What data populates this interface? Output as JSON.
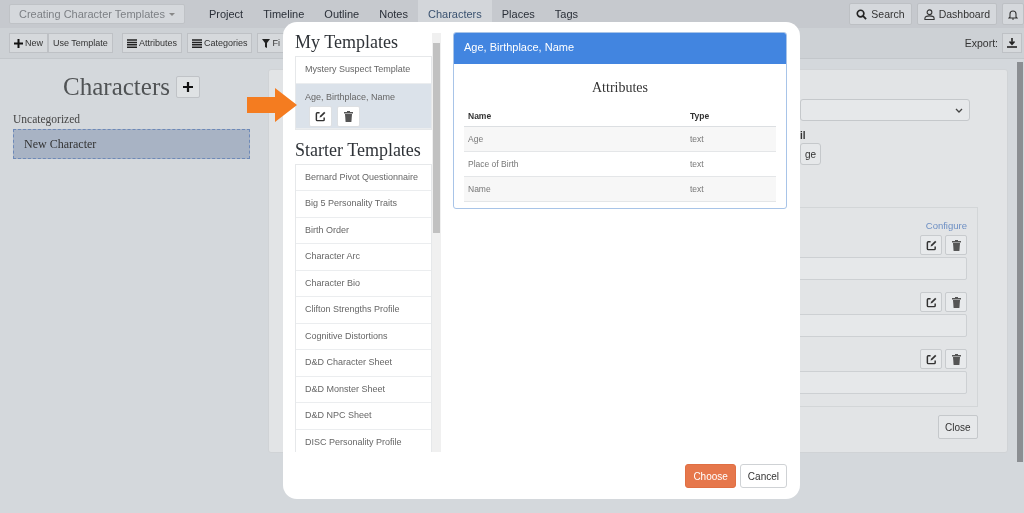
{
  "nav": {
    "project_selector": "Creating Character Templates",
    "tabs": [
      {
        "label": "Project",
        "selected": false
      },
      {
        "label": "Timeline",
        "selected": false
      },
      {
        "label": "Outline",
        "selected": false
      },
      {
        "label": "Notes",
        "selected": false
      },
      {
        "label": "Characters",
        "selected": true
      },
      {
        "label": "Places",
        "selected": false
      },
      {
        "label": "Tags",
        "selected": false
      }
    ],
    "search_button": "Search",
    "dashboard_button": "Dashboard"
  },
  "toolbar": {
    "buttons": [
      {
        "label": "New",
        "kind": "plus"
      },
      {
        "label": "Use Template",
        "kind": "plain"
      },
      {
        "label": "Attributes",
        "kind": "list"
      },
      {
        "label": "Categories",
        "kind": "list"
      },
      {
        "label": "Fi",
        "kind": "filter"
      }
    ],
    "export_label": "Export:"
  },
  "sidebar": {
    "title": "Characters",
    "group": "Uncategorized",
    "items": [
      {
        "label": "New Character",
        "selected": true
      }
    ]
  },
  "editor": {
    "field_label": "il",
    "image_button": "ge",
    "configure_link": "Configure",
    "close_button": "Close"
  },
  "dialog": {
    "my_templates": {
      "title": "My Templates",
      "items": [
        {
          "label": "Mystery Suspect Template",
          "selected": false
        },
        {
          "label": "Age, Birthplace, Name",
          "selected": true
        }
      ]
    },
    "starter_templates": {
      "title": "Starter Templates",
      "items": [
        {
          "label": "Bernard Pivot Questionnaire",
          "selected": false
        },
        {
          "label": "Big 5 Personality Traits",
          "selected": false
        },
        {
          "label": "Birth Order",
          "selected": false
        },
        {
          "label": "Character Arc",
          "selected": false
        },
        {
          "label": "Character Bio",
          "selected": false
        },
        {
          "label": "Clifton Strengths Profile",
          "selected": false
        },
        {
          "label": "Cognitive Distortions",
          "selected": false
        },
        {
          "label": "D&D Character Sheet",
          "selected": false
        },
        {
          "label": "D&D Monster Sheet",
          "selected": false
        },
        {
          "label": "D&D NPC Sheet",
          "selected": false
        },
        {
          "label": "DISC Personality Profile",
          "selected": false
        }
      ]
    },
    "preview": {
      "title": "Age, Birthplace, Name",
      "heading": "Attributes",
      "columns": [
        "Name",
        "Type"
      ],
      "rows": [
        [
          "Age",
          "text"
        ],
        [
          "Place of Birth",
          "text"
        ],
        [
          "Name",
          "text"
        ]
      ]
    },
    "choose_button": "Choose",
    "cancel_button": "Cancel"
  }
}
